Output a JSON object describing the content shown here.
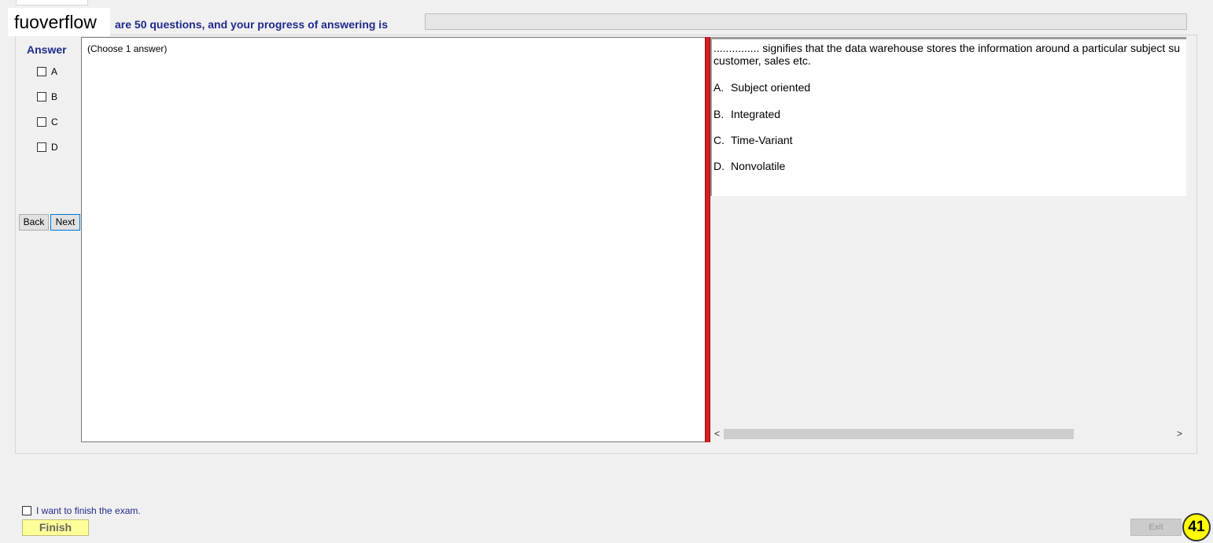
{
  "watermark": "fuoverflow",
  "header": {
    "progress_text": "are 50 questions, and your progress of answering is",
    "progress_fraction": 0
  },
  "answer_panel": {
    "label": "Answer",
    "options": [
      "A",
      "B",
      "C",
      "D"
    ],
    "back_label": "Back",
    "next_label": "Next",
    "instruction": "(Choose 1 answer)"
  },
  "question": {
    "text": "............... signifies that the data warehouse stores the information around a particular subject su\ncustomer, sales etc.",
    "options": [
      {
        "key": "A.",
        "text": "Subject oriented"
      },
      {
        "key": "B.",
        "text": "Integrated"
      },
      {
        "key": "C.",
        "text": "Time-Variant"
      },
      {
        "key": "D.",
        "text": "Nonvolatile"
      }
    ]
  },
  "scrollbar": {
    "left_icon": "chevron-left-icon",
    "right_icon": "chevron-right-icon",
    "left_glyph": "<",
    "right_glyph": ">"
  },
  "footer": {
    "finish_checkbox_label": "I want to finish the exam.",
    "finish_label": "Finish",
    "exit_label": "Exit",
    "page_badge": "41"
  },
  "colors": {
    "accent_blue": "#1f2a8c",
    "divider_red": "#d81e1e",
    "finish_yellow": "#ffff99",
    "badge_yellow": "#ffff00"
  }
}
